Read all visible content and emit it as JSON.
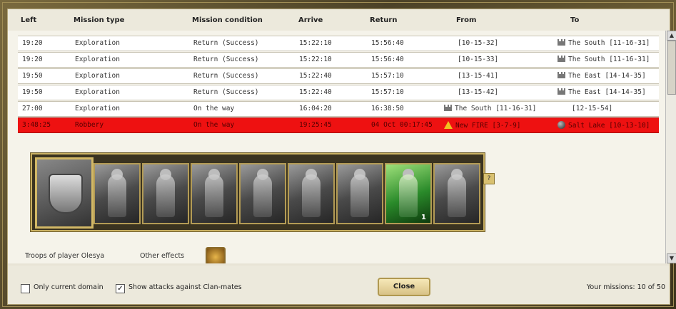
{
  "columns": {
    "left": "Left",
    "type": "Mission type",
    "condition": "Mission condition",
    "arrive": "Arrive",
    "ret": "Return",
    "from": "From",
    "to": "To"
  },
  "rows": [
    {
      "left": "19:20",
      "type": "Exploration",
      "condition": "Return (Success)",
      "arrive": "15:22:10",
      "ret": "15:56:40",
      "from": "[10-15-32]",
      "to": "The South [11-16-31]"
    },
    {
      "left": "19:20",
      "type": "Exploration",
      "condition": "Return (Success)",
      "arrive": "15:22:10",
      "ret": "15:56:40",
      "from": "[10-15-33]",
      "to": "The South [11-16-31]"
    },
    {
      "left": "19:50",
      "type": "Exploration",
      "condition": "Return (Success)",
      "arrive": "15:22:40",
      "ret": "15:57:10",
      "from": "[13-15-41]",
      "to": "The East [14-14-35]"
    },
    {
      "left": "19:50",
      "type": "Exploration",
      "condition": "Return (Success)",
      "arrive": "15:22:40",
      "ret": "15:57:10",
      "from": "[13-15-42]",
      "to": "The East [14-14-35]"
    },
    {
      "left": "27:00",
      "type": "Exploration",
      "condition": "On the way",
      "arrive": "16:04:20",
      "ret": "16:38:50",
      "from": "The South [11-16-31]",
      "to": "[12-15-54]"
    },
    {
      "left": "3:48:25",
      "type": "Robbery",
      "condition": "On the way",
      "arrive": "19:25:45",
      "ret": "04 Oct 00:17:45",
      "from": "New FIRE [3-7-9]",
      "to": "Salt Lake [10-13-10]"
    }
  ],
  "troops": {
    "count": "1",
    "help": "?"
  },
  "labels": {
    "troops_of": "Troops of player Olesya",
    "other_effects": "Other effects"
  },
  "footer": {
    "only_domain": "Only current domain",
    "show_attacks": "Show attacks against Clan-mates",
    "close": "Close",
    "missions": "Your missions: 10 of 50"
  },
  "icons": {
    "up": "▲",
    "down": "▼",
    "check": "✓"
  }
}
